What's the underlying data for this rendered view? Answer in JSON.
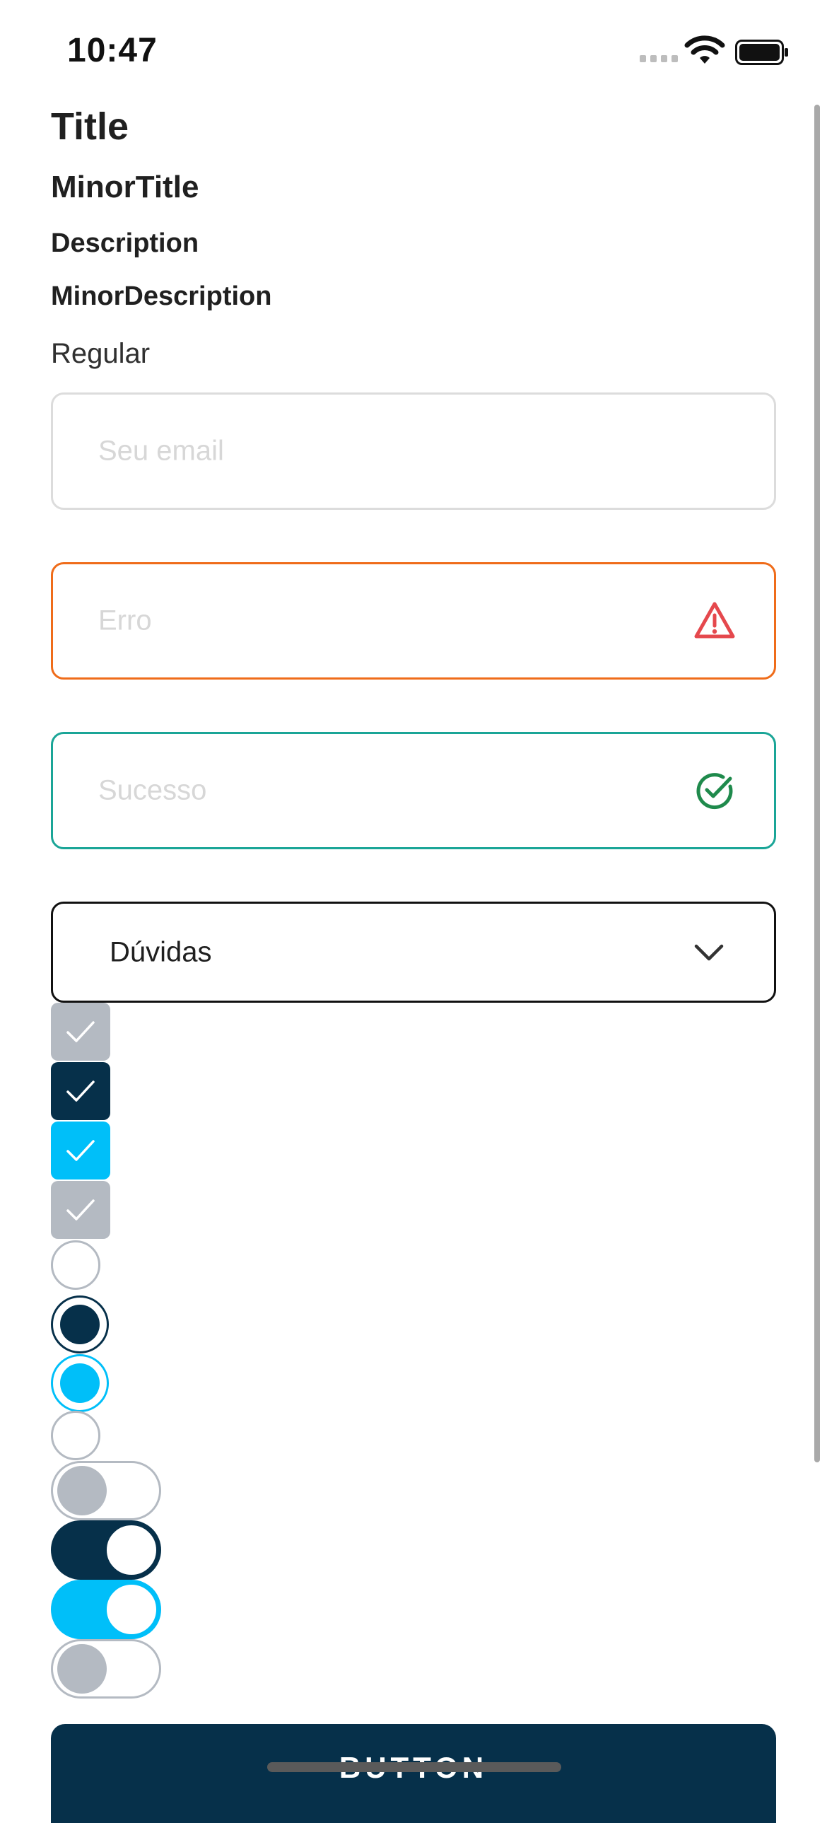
{
  "status_bar": {
    "time": "10:47"
  },
  "typography": {
    "title": "Title",
    "minor_title": "MinorTitle",
    "description": "Description",
    "minor_description": "MinorDescription",
    "regular": "Regular"
  },
  "inputs": {
    "email_placeholder": "Seu email",
    "error_placeholder": "Erro",
    "success_placeholder": "Sucesso"
  },
  "select": {
    "value": "Dúvidas"
  },
  "checkboxes": [
    {
      "state": "checked",
      "variant": "disabled"
    },
    {
      "state": "checked",
      "variant": "primary"
    },
    {
      "state": "checked",
      "variant": "accent"
    },
    {
      "state": "checked",
      "variant": "disabled"
    }
  ],
  "radios": [
    {
      "state": "unselected"
    },
    {
      "state": "selected",
      "variant": "primary"
    },
    {
      "state": "selected",
      "variant": "accent"
    },
    {
      "state": "unselected"
    }
  ],
  "toggles": [
    {
      "on": false
    },
    {
      "on": true,
      "variant": "primary"
    },
    {
      "on": true,
      "variant": "accent"
    },
    {
      "on": false
    }
  ],
  "button": {
    "label": "BUTTON"
  },
  "colors": {
    "primary": "#06304a",
    "accent": "#00bff9",
    "disabled": "#b4bac2",
    "error_border": "#ef6c1a",
    "error_icon": "#e5484d",
    "success_border": "#1aa597",
    "success_icon": "#1f8a4c"
  },
  "icons": [
    "wifi-icon",
    "battery-icon",
    "warning-icon",
    "check-circle-icon",
    "chevron-down-icon",
    "checkmark-icon"
  ]
}
